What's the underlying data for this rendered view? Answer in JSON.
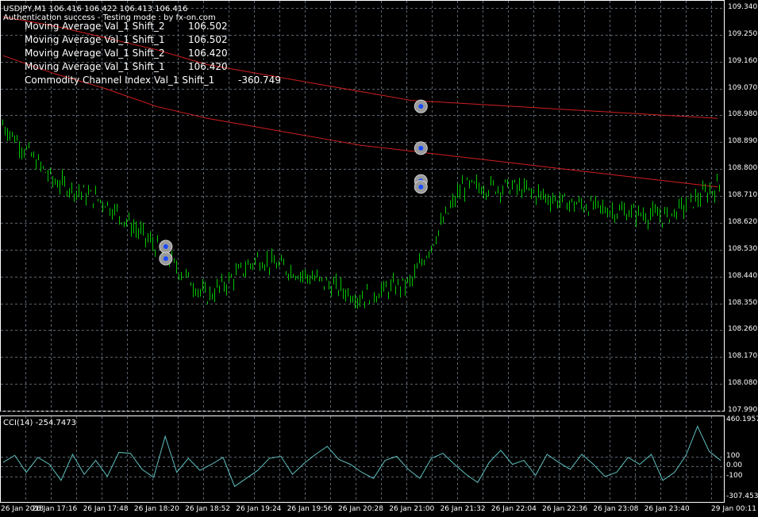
{
  "symbol_header": "USDJPY,M1  106.416 106.422 106.413 106.416",
  "status_text": "Authentication success - Testing mode : by fx-on.com",
  "indicators": [
    {
      "name": "Moving Average  Val_1  Shift_2",
      "value": "106.502"
    },
    {
      "name": "Moving Average  Val_1  Shift_1",
      "value": "106.502"
    },
    {
      "name": "Moving Average  Val_1  Shift_2",
      "value": "106.420"
    },
    {
      "name": "Moving Average  Val_1  Shift_1",
      "value": "106.420"
    },
    {
      "name": "Commodity Channel Index  Val_1  Shift_1",
      "value": "-360.749"
    }
  ],
  "price_axis": [
    "109.340",
    "109.250",
    "109.160",
    "109.070",
    "108.980",
    "108.890",
    "108.800",
    "108.710",
    "108.620",
    "108.530",
    "108.440",
    "108.350",
    "108.260",
    "108.170",
    "108.080",
    "107.990"
  ],
  "cci_label": "CCI(14) -254.7473",
  "cci_axis": [
    "460.1957",
    "100",
    "0.00",
    "-100",
    "-307.4539"
  ],
  "time_axis": [
    "26 Jan 2018",
    "26 Jan 17:16",
    "26 Jan 17:48",
    "26 Jan 18:20",
    "26 Jan 18:52",
    "26 Jan 19:24",
    "26 Jan 19:56",
    "26 Jan 20:28",
    "26 Jan 21:00",
    "26 Jan 21:32",
    "26 Jan 22:04",
    "26 Jan 22:36",
    "26 Jan 23:08",
    "26 Jan 23:40",
    "29 Jan 00:11"
  ],
  "colors": {
    "background": "#000000",
    "grid": "#5a6470",
    "candles": "#00c800",
    "ma_line": "#d21e1e",
    "cci_line": "#5fbfbf",
    "text": "#ffffff"
  },
  "chart_data": {
    "type": "line",
    "xlabel": "",
    "ylabel": "",
    "ylim": [
      107.99,
      109.34
    ],
    "x": [
      "26 Jan 2018",
      "26 Jan 17:16",
      "26 Jan 17:48",
      "26 Jan 18:20",
      "26 Jan 18:52",
      "26 Jan 19:24",
      "26 Jan 19:56",
      "26 Jan 20:28",
      "26 Jan 21:00",
      "26 Jan 21:32",
      "26 Jan 22:04",
      "26 Jan 22:36",
      "26 Jan 23:08",
      "26 Jan 23:40",
      "29 Jan 00:11"
    ],
    "series": [
      {
        "values": [
          108.95,
          108.76,
          108.69,
          108.54,
          108.37,
          108.5,
          108.44,
          108.37,
          108.42,
          108.74,
          108.74,
          108.69,
          108.66,
          108.64,
          108.74
        ]
      },
      {
        "values": [
          109.31,
          109.28,
          109.24,
          109.2,
          109.15,
          109.12,
          109.09,
          109.06,
          109.03,
          109.02,
          109.01,
          109.0,
          108.99,
          108.98,
          108.97
        ]
      },
      {
        "values": [
          109.18,
          109.12,
          109.07,
          109.01,
          108.97,
          108.94,
          108.91,
          108.88,
          108.86,
          108.84,
          108.82,
          108.8,
          108.78,
          108.76,
          108.74
        ]
      }
    ],
    "cci": {
      "ylim": [
        -307.4539,
        460.1957
      ],
      "values": [
        40,
        110,
        -60,
        90,
        20,
        -140,
        120,
        -80,
        60,
        -100,
        140,
        130,
        -30,
        -110,
        300,
        -60,
        80,
        -40,
        20,
        90,
        -200,
        -120,
        -40,
        80,
        100,
        -80,
        30,
        120,
        200,
        70,
        20,
        -60,
        -120,
        60,
        100,
        -30,
        -120,
        80,
        130,
        20,
        -80,
        -160,
        40,
        160,
        20,
        60,
        -90,
        120,
        40,
        -30,
        120,
        20,
        -100,
        -60,
        90,
        20,
        120,
        -140,
        -60,
        110,
        400,
        150,
        60
      ]
    },
    "trade_markers": [
      {
        "time": "26 Jan 18:20",
        "price": 108.54
      },
      {
        "time": "26 Jan 18:20",
        "price": 108.5
      },
      {
        "time": "26 Jan 21:00",
        "price": 109.01
      },
      {
        "time": "26 Jan 21:00",
        "price": 108.87
      },
      {
        "time": "26 Jan 21:00",
        "price": 108.76
      },
      {
        "time": "26 Jan 21:00",
        "price": 108.74
      }
    ]
  }
}
